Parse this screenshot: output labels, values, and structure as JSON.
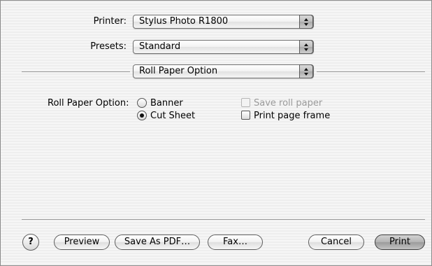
{
  "printer": {
    "label": "Printer:",
    "value": "Stylus Photo R1800"
  },
  "presets": {
    "label": "Presets:",
    "value": "Standard"
  },
  "panel": {
    "value": "Roll Paper Option"
  },
  "roll_paper": {
    "label": "Roll Paper Option:",
    "options": [
      {
        "label": "Banner",
        "selected": false
      },
      {
        "label": "Cut Sheet",
        "selected": true
      }
    ],
    "save_roll_paper": {
      "label": "Save roll paper",
      "checked": false,
      "enabled": false
    },
    "print_page_frame": {
      "label": "Print page frame",
      "checked": false,
      "enabled": true
    }
  },
  "footer": {
    "help": "?",
    "preview": "Preview",
    "save_pdf": "Save As PDF…",
    "fax": "Fax…",
    "cancel": "Cancel",
    "print": "Print"
  }
}
